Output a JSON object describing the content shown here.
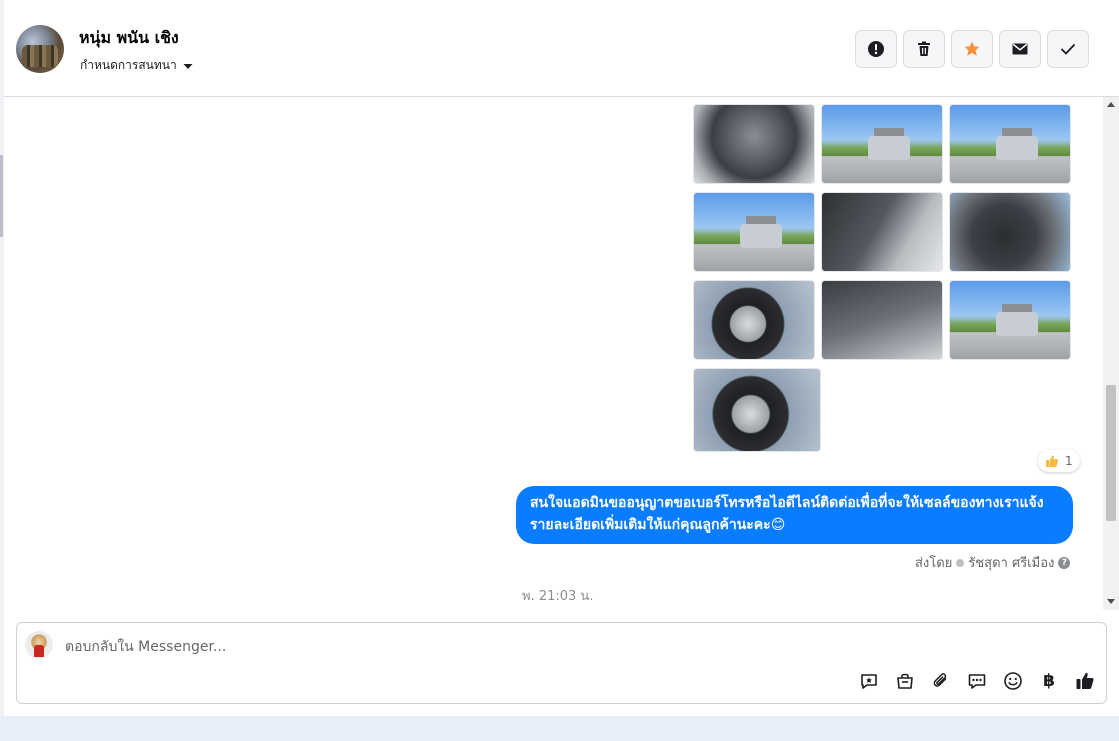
{
  "header": {
    "name": "หนุ่ม พนัน เชิง",
    "assign_label": "กำหนดการสนทนา"
  },
  "header_actions": [
    {
      "icon": "exclamation-icon"
    },
    {
      "icon": "trash-icon"
    },
    {
      "icon": "star-icon",
      "color": "#f7923b"
    },
    {
      "icon": "envelope-icon"
    },
    {
      "icon": "checkmark-icon"
    }
  ],
  "conversation": {
    "photos": [
      "engine-bay",
      "pickup-rack-rear",
      "pickup-side",
      "pickup-rear",
      "door-interior",
      "dashboard",
      "steel-wheel",
      "seats",
      "pickup-rear-angle",
      "alloy-wheel"
    ],
    "reaction": {
      "icon": "thumbs-up-icon",
      "count": "1"
    },
    "message": "สนใจแอดมินขออนุญาตขอเบอร์โทรหรือไอดีไลน์ติดต่อเพื่อที่จะให้เซลล์ของทางเราแจ้งรายละเอียดเพิ่มเติมให้แก่คุณลูกค้านะคะ😊",
    "sent_by_label": "ส่งโดย",
    "sender": "รัชสุดา ศรีเมือง",
    "timestamp": "พ. 21:03 น."
  },
  "composer": {
    "placeholder": "ตอบกลับใน Messenger...",
    "tools": [
      "saved-reply-icon",
      "shop-bag-icon",
      "paperclip-icon",
      "chat-dots-icon",
      "smiley-icon",
      "baht-icon",
      "like-icon"
    ],
    "baht_symbol": "฿"
  },
  "colors": {
    "bubble": "#0a7cff",
    "star": "#f7923b",
    "thumb": "#f5b942"
  }
}
